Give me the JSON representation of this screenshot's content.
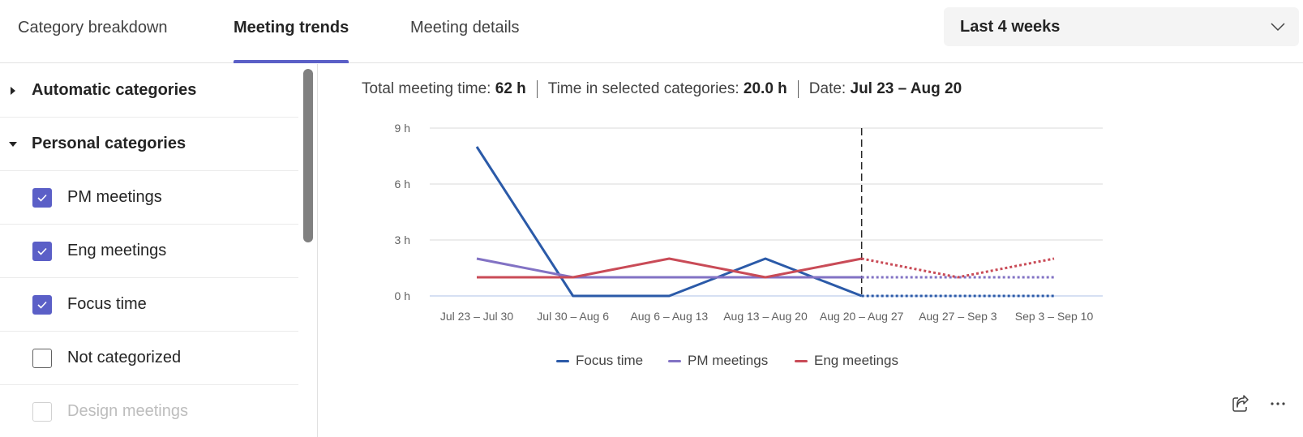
{
  "tabs": [
    {
      "label": "Category breakdown",
      "active": false
    },
    {
      "label": "Meeting trends",
      "active": true
    },
    {
      "label": "Meeting details",
      "active": false
    }
  ],
  "range_dropdown": {
    "selected": "Last 4 weeks",
    "icon": "chevron-down-icon"
  },
  "sidebar": {
    "groups": [
      {
        "label": "Automatic categories",
        "expanded": false,
        "icon": "caret-right-icon"
      },
      {
        "label": "Personal categories",
        "expanded": true,
        "icon": "caret-down-icon"
      }
    ],
    "items": [
      {
        "label": "PM meetings",
        "checked": true,
        "disabled": false
      },
      {
        "label": "Eng meetings",
        "checked": true,
        "disabled": false
      },
      {
        "label": "Focus time",
        "checked": true,
        "disabled": false
      },
      {
        "label": "Not categorized",
        "checked": false,
        "disabled": false
      },
      {
        "label": "Design meetings",
        "checked": false,
        "disabled": true
      }
    ]
  },
  "summary": {
    "total_label": "Total meeting time:",
    "total_value": "62 h",
    "selected_label": "Time in selected categories:",
    "selected_value": "20.0 h",
    "date_label": "Date:",
    "date_value": "Jul 23 – Aug 20"
  },
  "actions": {
    "share_icon": "share-icon",
    "more_icon": "more-icon"
  },
  "chart_data": {
    "type": "line",
    "title": "",
    "xlabel": "",
    "ylabel": "",
    "categories": [
      "Jul 23 – Jul 30",
      "Jul 30 – Aug 6",
      "Aug 6 – Aug 13",
      "Aug 13 – Aug 20",
      "Aug 20 – Aug 27",
      "Aug 27 – Sep 3",
      "Sep 3 – Sep 10"
    ],
    "y_ticks": [
      0,
      3,
      6,
      9
    ],
    "y_tick_labels": [
      "0 h",
      "3 h",
      "6 h",
      "9 h"
    ],
    "ylim": [
      0,
      9
    ],
    "grid": true,
    "current_marker_category": "Aug 20 – Aug 27",
    "projected_from_index": 4,
    "legend_position": "bottom-center",
    "series": [
      {
        "name": "Focus time",
        "color": "#2b5aa8",
        "values": [
          8,
          0,
          0,
          2,
          0,
          0,
          0
        ]
      },
      {
        "name": "PM meetings",
        "color": "#8272c4",
        "values": [
          2,
          1,
          1,
          1,
          1,
          1,
          1
        ]
      },
      {
        "name": "Eng meetings",
        "color": "#c94b57",
        "values": [
          1,
          1,
          2,
          1,
          2,
          1,
          2
        ]
      }
    ]
  }
}
